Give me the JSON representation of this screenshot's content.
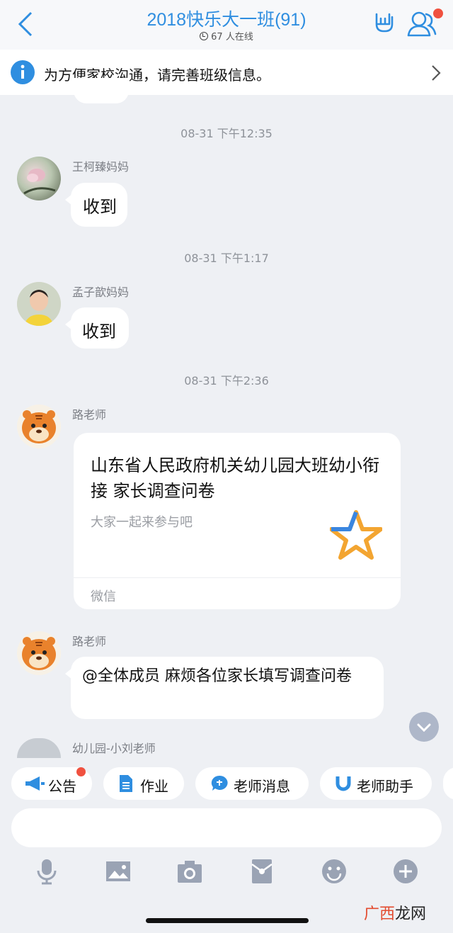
{
  "header": {
    "back_icon": "chevron-left-icon",
    "title": "2018快乐大一班(91)",
    "online": "67 人在线"
  },
  "notice": {
    "text": "为方便家校沟通，请完善班级信息。"
  },
  "messages": [
    {
      "time": "08-31 下午12:35",
      "sender": "王柯臻妈妈",
      "text": "收到"
    },
    {
      "time": "08-31 下午1:17",
      "sender": "孟子歆妈妈",
      "text": "收到"
    },
    {
      "time": "08-31 下午2:36",
      "sender": "路老师",
      "card": {
        "title": "山东省人民政府机关幼儿园大班幼小衔接 家长调查问卷",
        "subtitle": "大家一起来参与吧",
        "source": "微信"
      }
    },
    {
      "sender": "路老师",
      "text": "@全体成员 麻烦各位家长填写调查问卷"
    },
    {
      "sender": "幼儿园-小刘老师"
    }
  ],
  "quick_actions": [
    {
      "label": "公告",
      "icon": "megaphone-icon"
    },
    {
      "label": "作业",
      "icon": "document-icon"
    },
    {
      "label": "老师消息",
      "icon": "teacher-chat-icon"
    },
    {
      "label": "老师助手",
      "icon": "magnet-icon"
    }
  ],
  "toolbar": [
    "microphone-icon",
    "image-icon",
    "camera-icon",
    "red-packet-icon",
    "emoji-icon",
    "plus-icon"
  ],
  "watermark": {
    "part1": "广西",
    "part2": "龙网"
  },
  "colors": {
    "accent": "#2f8ee0",
    "badge": "#f0513f",
    "bubble": "#ffffff",
    "background": "#eef0f4"
  }
}
